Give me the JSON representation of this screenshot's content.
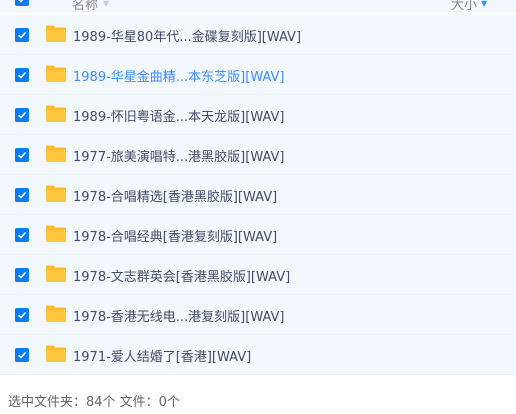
{
  "header": {
    "name_label": "名称",
    "size_label": "大小"
  },
  "files": [
    {
      "name": "1989-华星80年代...金碟复刻版][WAV]",
      "checked": true
    },
    {
      "name": "1989-华星金曲精...本东芝版][WAV]",
      "checked": true,
      "hover": true
    },
    {
      "name": "1989-怀旧粤语金...本天龙版][WAV]",
      "checked": true
    },
    {
      "name": "1977-旅美演唱特...港黑胶版][WAV]",
      "checked": true
    },
    {
      "name": "1978-合唱精选[香港黑胶版][WAV]",
      "checked": true
    },
    {
      "name": "1978-合唱经典[香港复刻版][WAV]",
      "checked": true
    },
    {
      "name": "1978-文志群英会[香港黑胶版][WAV]",
      "checked": true
    },
    {
      "name": "1978-香港无线电...港复刻版][WAV]",
      "checked": true
    },
    {
      "name": "1971-爱人结婚了[香港][WAV]",
      "checked": true
    }
  ],
  "status": {
    "text": "选中文件夹：84个 文件：0个"
  },
  "colors": {
    "accent": "#0a7cf3",
    "folder": "#ffc63d",
    "row_bg": "#f3f7fe",
    "hover_text": "#3b8cff"
  }
}
